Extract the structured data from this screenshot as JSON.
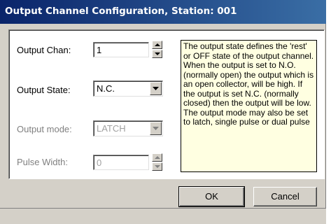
{
  "window": {
    "title": "Output Channel Configuration, Station: 001"
  },
  "form": {
    "output_chan": {
      "label": "Output Chan:",
      "value": "1"
    },
    "output_state": {
      "label": "Output State:",
      "value": "N.C."
    },
    "output_mode": {
      "label": "Output mode:",
      "value": "LATCH"
    },
    "pulse_width": {
      "label": "Pulse Width:",
      "value": "0"
    }
  },
  "help": {
    "text": "The output state defines the 'rest' or OFF state of the output channel. When the output is set to N.O. (normally open) the output which is an open collector, will be high. If the output is set N.C. (normally closed) then the output will be low. The output mode may also be set to  latch, single pulse or dual pulse"
  },
  "buttons": {
    "ok": "OK",
    "cancel": "Cancel"
  },
  "icons": {
    "spin_up": "spin-up-arrow-icon",
    "spin_down": "spin-down-arrow-icon",
    "dropdown": "chevron-down-icon"
  }
}
